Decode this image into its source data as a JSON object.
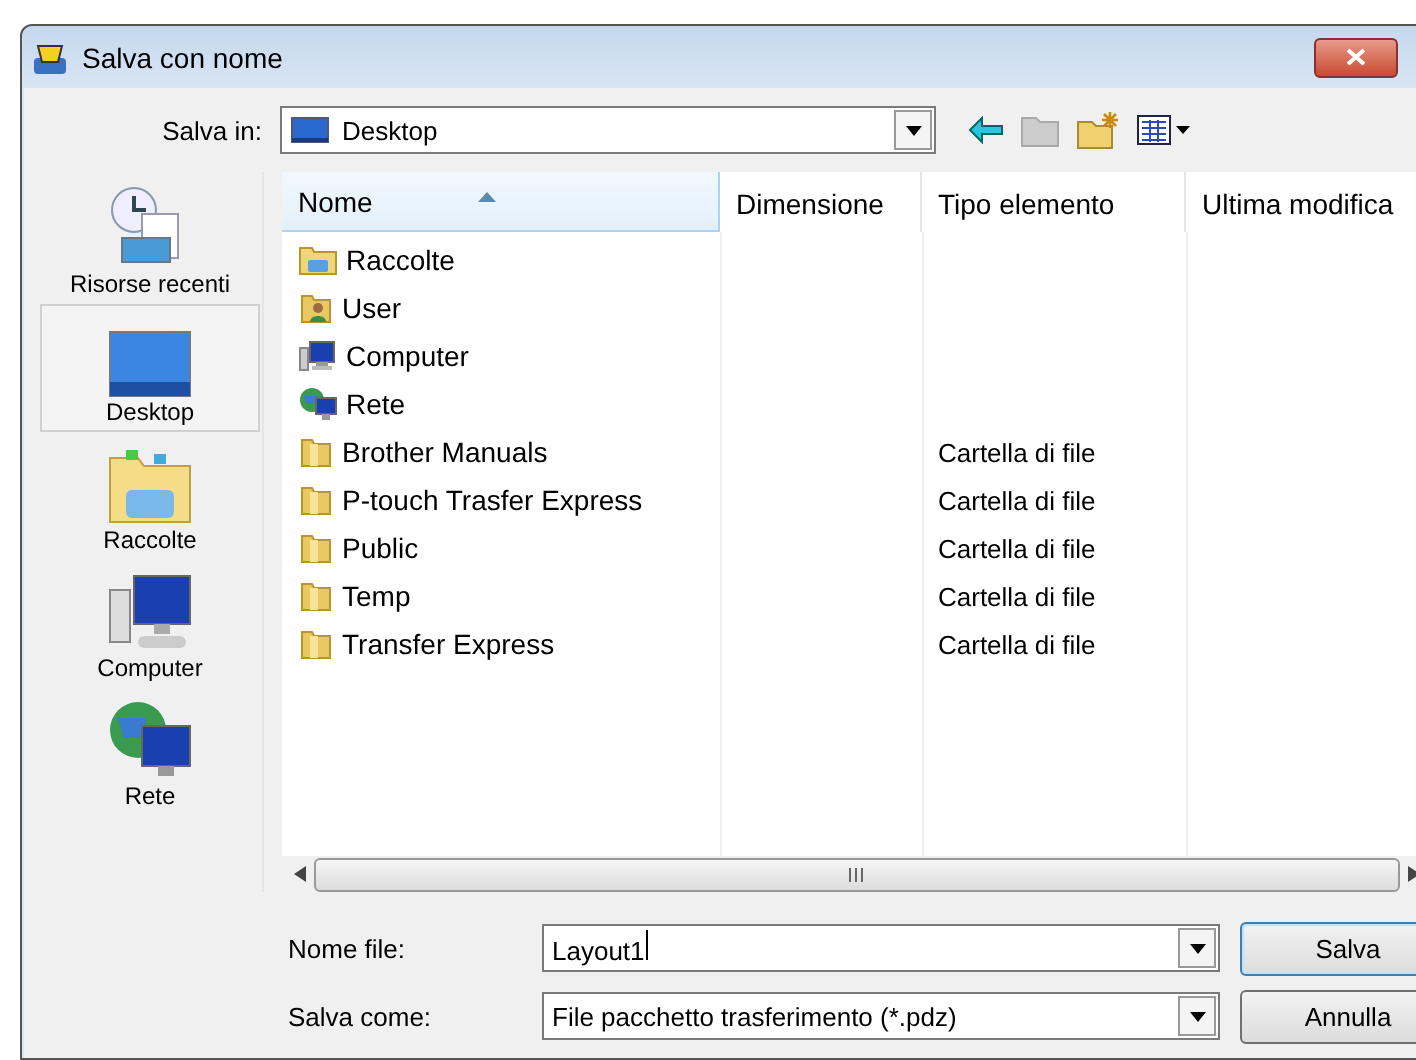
{
  "window": {
    "title": "Salva con nome"
  },
  "save_in": {
    "label": "Salva in:",
    "value": "Desktop"
  },
  "places": [
    {
      "label": "Risorse recenti",
      "kind": "recent",
      "selected": false
    },
    {
      "label": "Desktop",
      "kind": "desktop",
      "selected": true
    },
    {
      "label": "Raccolte",
      "kind": "library",
      "selected": false
    },
    {
      "label": "Computer",
      "kind": "computer",
      "selected": false
    },
    {
      "label": "Rete",
      "kind": "network",
      "selected": false
    }
  ],
  "columns": [
    {
      "label": "Nome",
      "sorted": true
    },
    {
      "label": "Dimensione",
      "sorted": false
    },
    {
      "label": "Tipo elemento",
      "sorted": false
    },
    {
      "label": "Ultima modifica",
      "sorted": false
    }
  ],
  "files": [
    {
      "name": "Raccolte",
      "kind": "library"
    },
    {
      "name": "User",
      "kind": "user"
    },
    {
      "name": "Computer",
      "kind": "computer"
    },
    {
      "name": "Rete",
      "kind": "network"
    },
    {
      "name": "Brother Manuals",
      "kind": "folder",
      "type": "Cartella di file"
    },
    {
      "name": "P-touch Trasfer Express",
      "kind": "folder",
      "type": "Cartella di file"
    },
    {
      "name": "Public",
      "kind": "folder",
      "type": "Cartella di file"
    },
    {
      "name": "Temp",
      "kind": "folder",
      "type": "Cartella di file"
    },
    {
      "name": "Transfer Express",
      "kind": "folder",
      "type": "Cartella di file"
    }
  ],
  "file_name": {
    "label": "Nome file:",
    "value": "Layout1"
  },
  "save_as": {
    "label": "Salva come:",
    "value": "File pacchetto trasferimento (*.pdz)"
  },
  "buttons": [
    "Salva",
    "Annulla"
  ]
}
